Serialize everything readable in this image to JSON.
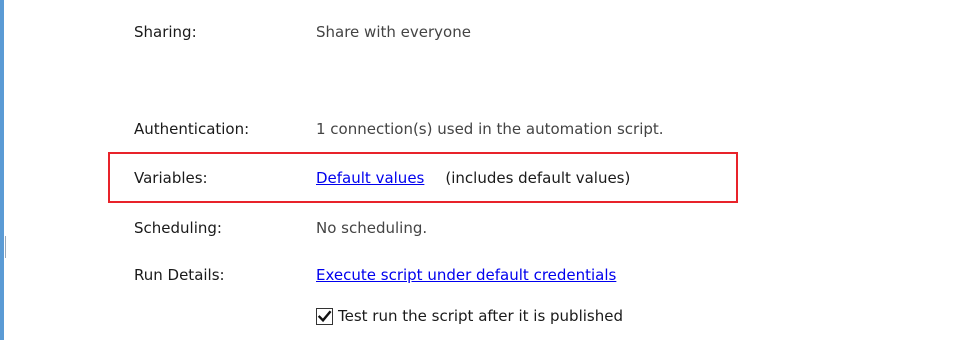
{
  "rows": {
    "sharing": {
      "label": "Sharing:",
      "value": "Share with everyone"
    },
    "authentication": {
      "label": "Authentication:",
      "value": "1 connection(s) used in the automation script."
    },
    "variables": {
      "label": "Variables:",
      "link": "Default values",
      "note": "(includes default values)"
    },
    "scheduling": {
      "label": "Scheduling:",
      "value": "No scheduling."
    },
    "run_details": {
      "label": "Run Details:",
      "link": "Execute script under default credentials"
    }
  },
  "test_run": {
    "label": "Test run the script after it is published",
    "checked": true
  },
  "colors": {
    "highlight_border": "#e8232a",
    "link": "#0000ee",
    "left_border": "#5b9bd5"
  }
}
